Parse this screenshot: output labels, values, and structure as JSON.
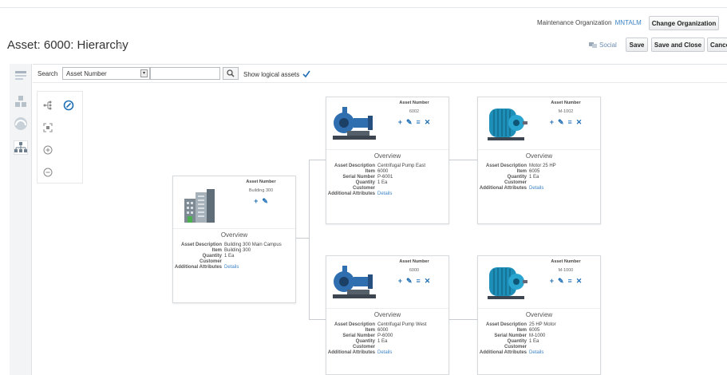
{
  "header": {
    "maintenance_org_label": "Maintenance Organization",
    "maintenance_org_value": "MNTALM",
    "change_org_button": "Change Organization",
    "page_title": "Asset: 6000: Hierarchy",
    "social_label": "Social",
    "save_button": "Save",
    "save_close_button": "Save and Close",
    "cancel_button": "Cancel"
  },
  "search": {
    "label": "Search",
    "field_value": "Asset Number",
    "show_logical_label": "Show logical assets",
    "show_logical_checked": true
  },
  "colors": {
    "accent": "#1f6fb5",
    "link": "#3b82c4",
    "card_border": "#d7dadd"
  },
  "cards": {
    "building": {
      "header_label": "Asset Number",
      "asset_number": "Building 300",
      "overview": "Overview",
      "fields": [
        {
          "k": "Asset Description",
          "v": "Building 300 Main Campus"
        },
        {
          "k": "Item",
          "v": "Building 300"
        },
        {
          "k": "Quantity",
          "v": "1 Ea"
        },
        {
          "k": "Customer",
          "v": ""
        },
        {
          "k": "Additional Attributes",
          "v": "Details"
        }
      ]
    },
    "pump_east": {
      "header_label": "Asset Number",
      "asset_number": "6002",
      "overview": "Overview",
      "fields": [
        {
          "k": "Asset Description",
          "v": "Centrifugal Pump East"
        },
        {
          "k": "Item",
          "v": "6000"
        },
        {
          "k": "Serial Number",
          "v": "P-6001"
        },
        {
          "k": "Quantity",
          "v": "1 Ea"
        },
        {
          "k": "Customer",
          "v": ""
        },
        {
          "k": "Additional Attributes",
          "v": "Details"
        }
      ]
    },
    "motor_1002": {
      "header_label": "Asset Number",
      "asset_number": "M-1002",
      "overview": "Overview",
      "fields": [
        {
          "k": "Asset Description",
          "v": "Motor 25 HP"
        },
        {
          "k": "Item",
          "v": "6005"
        },
        {
          "k": "Quantity",
          "v": "1 Ea"
        },
        {
          "k": "Customer",
          "v": ""
        },
        {
          "k": "Additional Attributes",
          "v": "Details"
        }
      ]
    },
    "pump_west": {
      "header_label": "Asset Number",
      "asset_number": "6000",
      "overview": "Overview",
      "fields": [
        {
          "k": "Asset Description",
          "v": "Centrifugal Pump West"
        },
        {
          "k": "Item",
          "v": "6000"
        },
        {
          "k": "Serial Number",
          "v": "P-6000"
        },
        {
          "k": "Quantity",
          "v": "1 Ea"
        },
        {
          "k": "Customer",
          "v": ""
        },
        {
          "k": "Additional Attributes",
          "v": "Details"
        }
      ]
    },
    "motor_1000": {
      "header_label": "Asset Number",
      "asset_number": "M-1000",
      "overview": "Overview",
      "fields": [
        {
          "k": "Asset Description",
          "v": "25 HP Motor"
        },
        {
          "k": "Item",
          "v": "6005"
        },
        {
          "k": "Serial Number",
          "v": "M-1000"
        },
        {
          "k": "Quantity",
          "v": "1 Ea"
        },
        {
          "k": "Customer",
          "v": ""
        },
        {
          "k": "Additional Attributes",
          "v": "Details"
        }
      ]
    }
  }
}
